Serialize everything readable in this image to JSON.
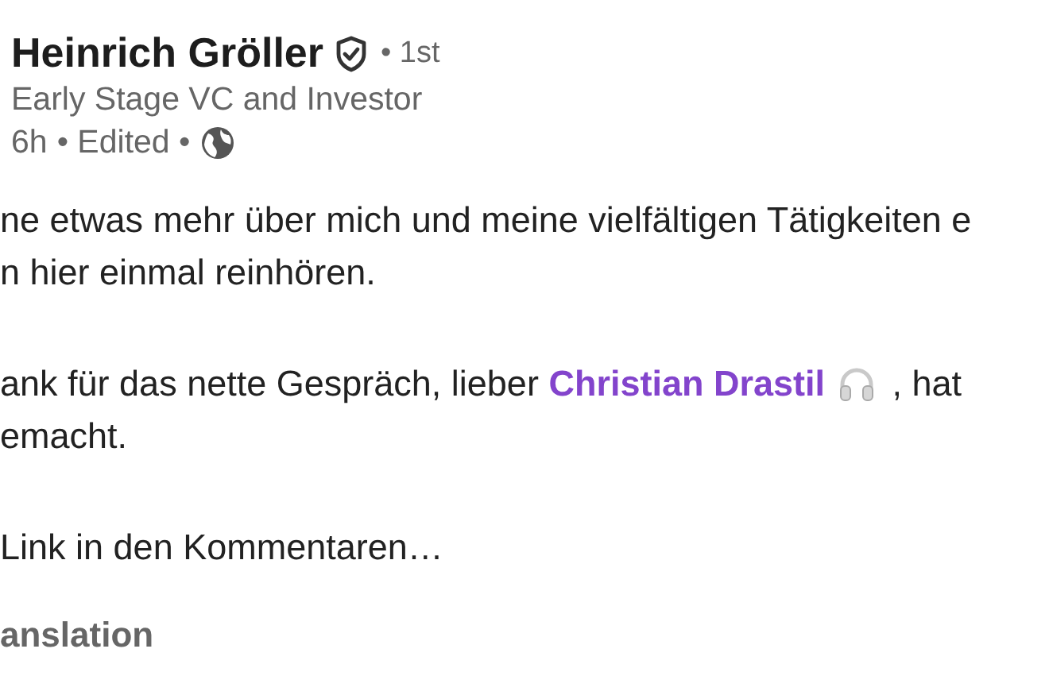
{
  "author": {
    "name": "Heinrich Gröller",
    "verified": true,
    "connection": "• 1st",
    "headline": "Early Stage VC and Investor",
    "time": "6h",
    "edited": "• Edited •",
    "public": true
  },
  "paragraphs": [
    {
      "lines": [
        {
          "text": "ne etwas mehr über mich und meine vielfältigen Tätigkeiten e"
        },
        {
          "text": "n hier einmal reinhören."
        }
      ]
    },
    {
      "lines": [
        {
          "text": "ank für das nette Gespräch, lieber ",
          "mention": "Christian Drastil",
          "after": " , hat"
        },
        {
          "text": "emacht."
        }
      ]
    },
    {
      "lines": [
        {
          "text": "Link in den Kommentaren…"
        }
      ]
    }
  ],
  "translation_link": "anslation"
}
